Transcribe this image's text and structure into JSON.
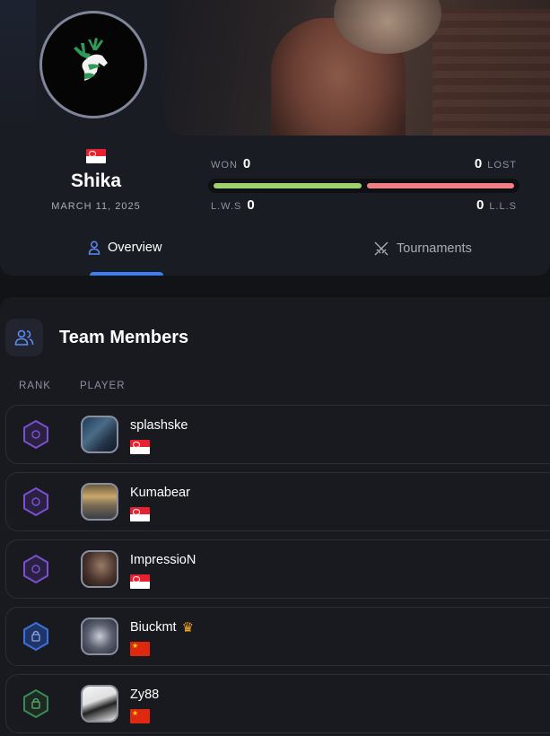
{
  "team": {
    "name": "Shika",
    "date": "MARCH 11, 2025",
    "flag": "sg"
  },
  "stats": {
    "won_label": "WON",
    "won": "0",
    "lost_label": "LOST",
    "lost": "0",
    "lws_label": "L.W.S",
    "lws": "0",
    "lls_label": "L.L.S",
    "lls": "0"
  },
  "tabs": [
    {
      "label": "Overview",
      "icon": "user-icon",
      "active": true
    },
    {
      "label": "Tournaments",
      "icon": "crossed-swords-icon",
      "active": false
    }
  ],
  "members": {
    "title": "Team Members",
    "col_rank": "RANK",
    "col_player": "PLAYER",
    "rows": [
      {
        "name": "splashske",
        "flag": "sg",
        "rank": "purple",
        "captain": false
      },
      {
        "name": "Kumabear",
        "flag": "sg",
        "rank": "purple",
        "captain": false
      },
      {
        "name": "ImpressioN",
        "flag": "sg",
        "rank": "purple",
        "captain": false
      },
      {
        "name": "Biuckmt",
        "flag": "cn",
        "rank": "blue",
        "captain": true
      },
      {
        "name": "Zy88",
        "flag": "cn",
        "rank": "green",
        "captain": false
      }
    ]
  },
  "colors": {
    "won_bar": "#9fd06e",
    "lost_bar": "#f07f86",
    "accent": "#3c7ef5",
    "crown": "#f6a623"
  }
}
